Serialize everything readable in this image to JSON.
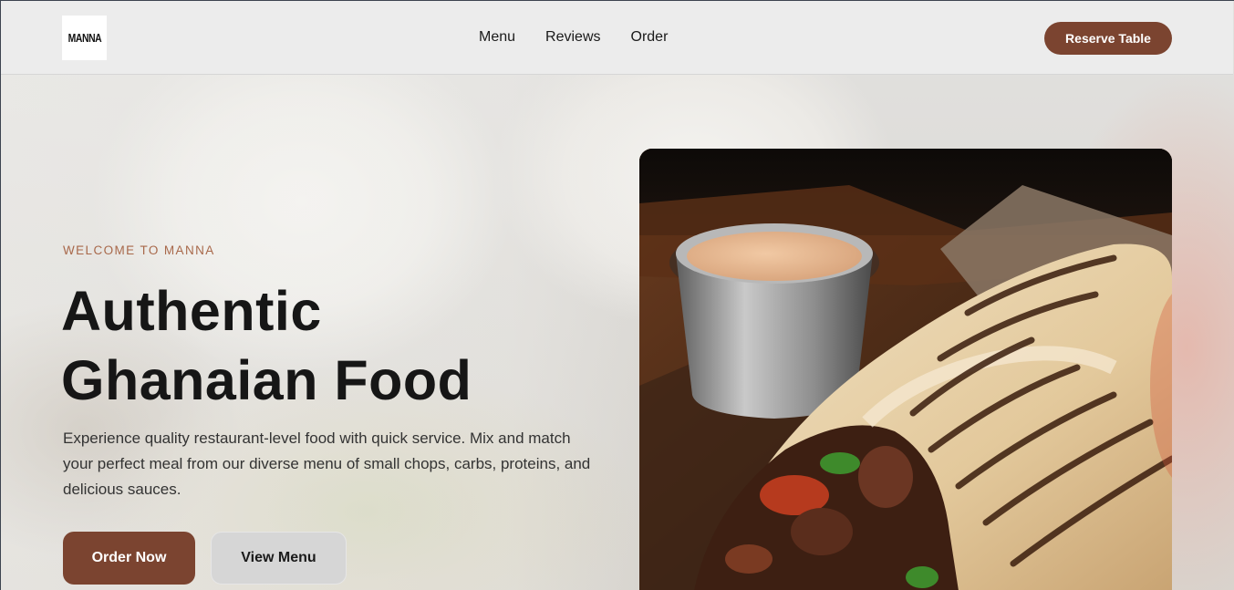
{
  "brand": {
    "logo_text": "MANNA"
  },
  "nav": {
    "items": [
      {
        "label": "Menu"
      },
      {
        "label": "Reviews"
      },
      {
        "label": "Order"
      }
    ],
    "reserve_label": "Reserve Table"
  },
  "hero": {
    "eyebrow": "WELCOME TO MANNA",
    "headline_line1": "Authentic",
    "headline_line2": "Ghanaian Food",
    "lead": "Experience quality restaurant-level food with quick service. Mix and match your perfect meal from our diverse menu of small chops, carbs, proteins, and delicious sauces.",
    "primary_cta": "Order Now",
    "secondary_cta": "View Menu",
    "background_image": "plated-food-photo",
    "feature_image": "shawarma-wrap-with-dipping-sauce-photo"
  },
  "colors": {
    "accent": "#7b4430",
    "eyebrow": "#a8684a",
    "header_bg": "#ececec",
    "secondary_button": "#d6d6d6"
  }
}
